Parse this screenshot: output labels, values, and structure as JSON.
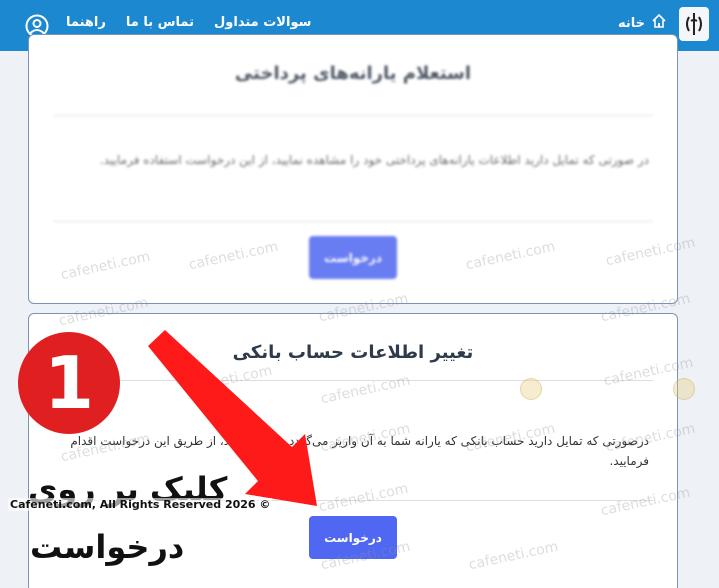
{
  "navbar": {
    "home_label": "خانه",
    "links": [
      "سوالات متداول",
      "تماس با ما",
      "راهنما"
    ],
    "icons": [
      "emblem-icon",
      "home-icon",
      "user-icon"
    ]
  },
  "cards": [
    {
      "title": "استعلام یارانه‌های پرداختی",
      "description": "در صورتی که تمایل دارید اطلاعات یارانه‌های پرداختی خود را مشاهده نمایید، از این درخواست استفاده فرمایید.",
      "button_label": "درخواست"
    },
    {
      "title": "تغییر اطلاعات حساب بانکی",
      "description": "درصورتی که تمایل دارید حساب بانکی که یارانه شما به آن واریز می‌گردد را تغییر دهید، از طریق این درخواست اقدام فرمایید.",
      "button_label": "درخواست"
    }
  ],
  "annotation": {
    "badge_number": "1",
    "line1": "کلیک بر روی",
    "line2": "درخواست",
    "copyright": "Cafeneti.com, All Rights Reserved 2026 ©"
  },
  "watermark": {
    "text": "cafeneti.com"
  },
  "colors": {
    "navbar": "#1b88d0",
    "button": "#4f67f1",
    "badge": "#e02020",
    "arrow": "#ff1a1a",
    "card_border": "#7a93b8"
  }
}
